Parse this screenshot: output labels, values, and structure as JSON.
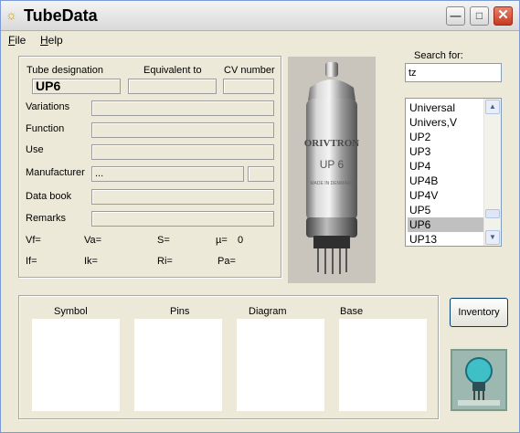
{
  "window": {
    "title": "TubeData",
    "controls": [
      "minimize-icon",
      "maximize-icon",
      "close-icon"
    ]
  },
  "menu": [
    {
      "label": "File",
      "accel": "F",
      "rest": "ile"
    },
    {
      "label": "Help",
      "accel": "H",
      "rest": "elp"
    }
  ],
  "details": {
    "tube_designation_label": "Tube designation",
    "equivalent_label": "Equivalent to",
    "cv_number_label": "CV number",
    "tube_designation_value": "UP6",
    "equivalent_value": "",
    "cv_number_value": "",
    "rows": [
      {
        "label": "Variations",
        "value": ""
      },
      {
        "label": "Function",
        "value": ""
      },
      {
        "label": "Use",
        "value": ""
      },
      {
        "label": "Manufacturer",
        "value": "..."
      },
      {
        "label": "Data book",
        "value": ""
      },
      {
        "label": "Remarks",
        "value": ""
      }
    ],
    "params_row1": [
      {
        "label": "Vf=",
        "value": ""
      },
      {
        "label": "Va=",
        "value": ""
      },
      {
        "label": "S=",
        "value": ""
      },
      {
        "label": "µ=",
        "value": "0"
      }
    ],
    "params_row2": [
      {
        "label": "If=",
        "value": ""
      },
      {
        "label": "Ik=",
        "value": ""
      },
      {
        "label": "Ri=",
        "value": ""
      },
      {
        "label": "Pa=",
        "value": ""
      }
    ]
  },
  "photo": {
    "brand": "ORIVTRON",
    "tube_type": "UP 6",
    "made_in": "MADE IN DENMARK"
  },
  "search": {
    "label": "Search for:",
    "value": "tz"
  },
  "list": {
    "items": [
      "Universal",
      "Univers,V",
      "UP2",
      "UP3",
      "UP4",
      "UP4B",
      "UP4V",
      "UP5",
      "UP6",
      "UP13"
    ],
    "selected": "UP6"
  },
  "bottom": {
    "symbol_label": "Symbol",
    "pins_label": "Pins",
    "diagram_label": "Diagram",
    "base_label": "Base"
  },
  "inventory_button": "Inventory"
}
